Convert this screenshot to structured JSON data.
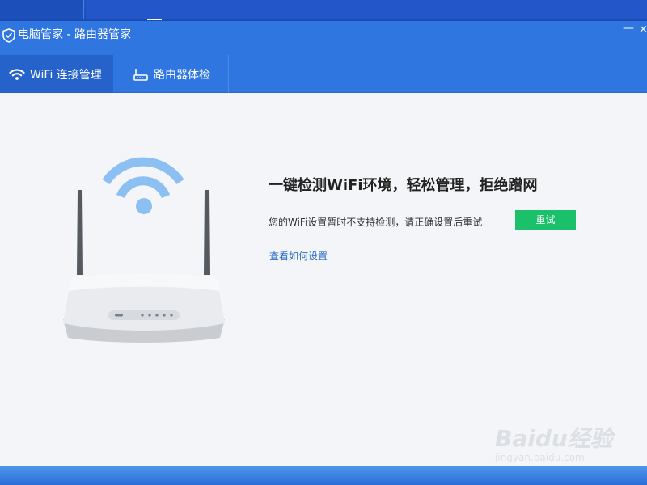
{
  "window": {
    "title": "电脑管家 - 路由器管家",
    "minimize_glyph": "—",
    "close_glyph": "×",
    "icon": "shield-icon"
  },
  "tabs": [
    {
      "label": "WiFi 连接管理",
      "icon": "wifi-icon",
      "active": true
    },
    {
      "label": "路由器体检",
      "icon": "router-icon",
      "active": false
    }
  ],
  "main": {
    "headline": "一键检测WiFi环境，轻松管理，拒绝蹭网",
    "status_text": "您的WiFi设置暂时不支持检测，请正确设置后重试",
    "retry_label": "重试",
    "help_link": "查看如何设置"
  },
  "watermark": {
    "brand": "Baidu经验",
    "url": "jingyan.baidu.com"
  },
  "colors": {
    "titlebar": "#2f76e0",
    "active_tab": "#2562c9",
    "retry_button": "#1bc06a",
    "link": "#2a6cc4",
    "wifi_icon": "#8cc0f2"
  }
}
